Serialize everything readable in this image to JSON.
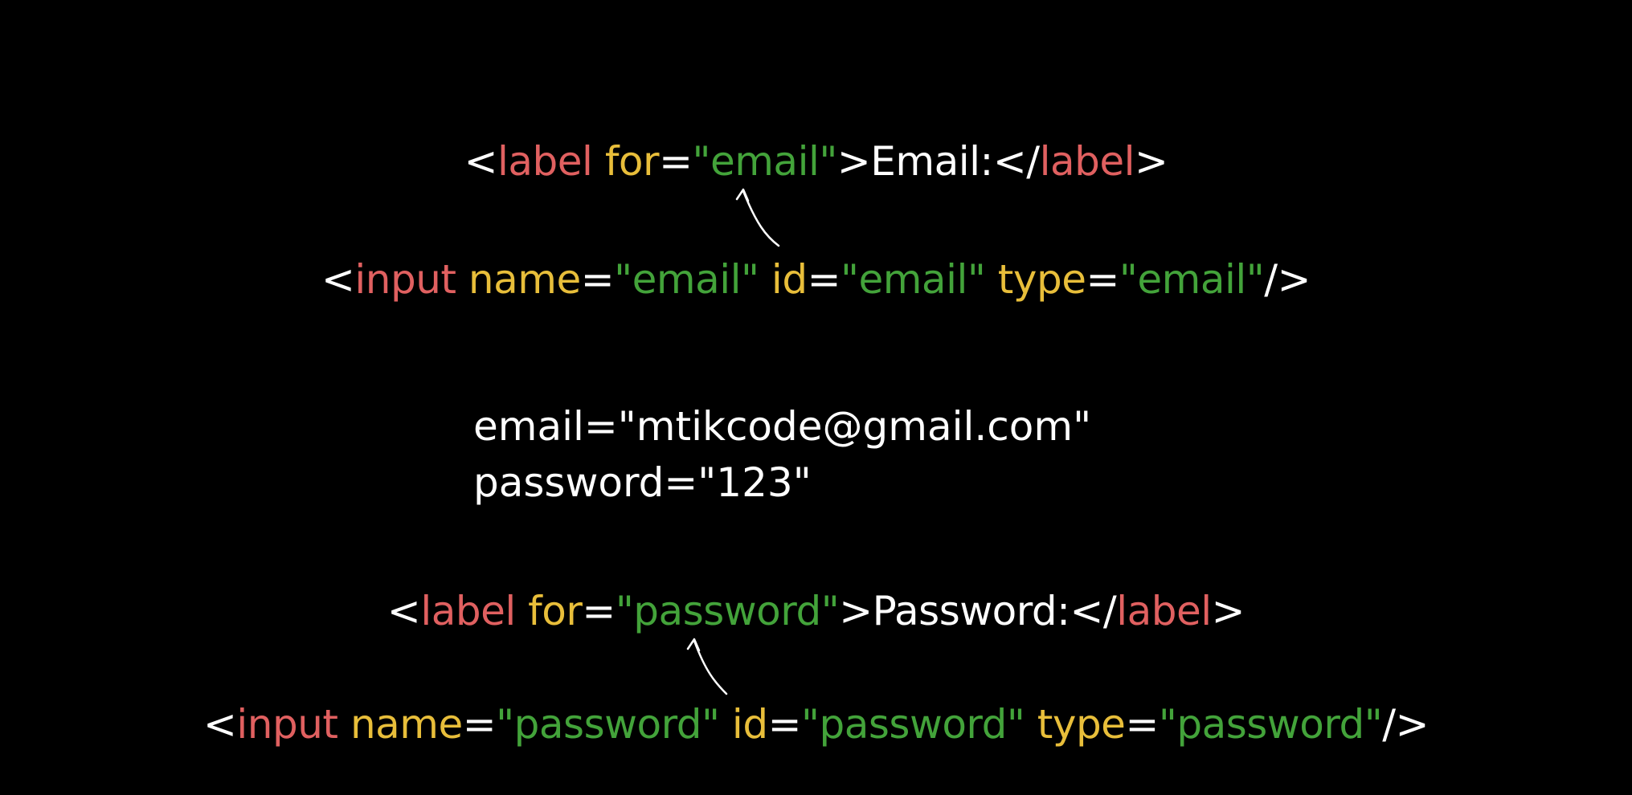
{
  "colors": {
    "background": "#000000",
    "tag": "#e06060",
    "attribute": "#e8be3a",
    "string": "#43a33a",
    "text": "#ffffff"
  },
  "line1": {
    "lt": "<",
    "tag": "label",
    "attr_for": "for",
    "eq": "=",
    "val_for": "\"email\"",
    "gt": ">",
    "text": "Email:",
    "close_lt": "</",
    "close_tag": "label",
    "close_gt": ">"
  },
  "line2": {
    "lt": "<",
    "tag": "input",
    "attr_name": "name",
    "eq1": "=",
    "val_name": "\"email\"",
    "attr_id": "id",
    "eq2": "=",
    "val_id": "\"email\"",
    "attr_type": "type",
    "eq3": "=",
    "val_type": "\"email\"",
    "end": "/>"
  },
  "credentials": {
    "email_line": "email=\"mtikcode@gmail.com\"",
    "password_line": "password=\"123\""
  },
  "line3": {
    "lt": "<",
    "tag": "label",
    "attr_for": "for",
    "eq": "=",
    "val_for": "\"password\"",
    "gt": ">",
    "text": "Password:",
    "close_lt": "</",
    "close_tag": "label",
    "close_gt": ">"
  },
  "line4": {
    "lt": "<",
    "tag": "input",
    "attr_name": "name",
    "eq1": "=",
    "val_name": "\"password\"",
    "attr_id": "id",
    "eq2": "=",
    "val_id": "\"password\"",
    "attr_type": "type",
    "eq3": "=",
    "val_type": "\"password\"",
    "end": "/>"
  },
  "icons": {
    "arrow_email": "curved-arrow-icon",
    "arrow_password": "curved-arrow-icon"
  }
}
